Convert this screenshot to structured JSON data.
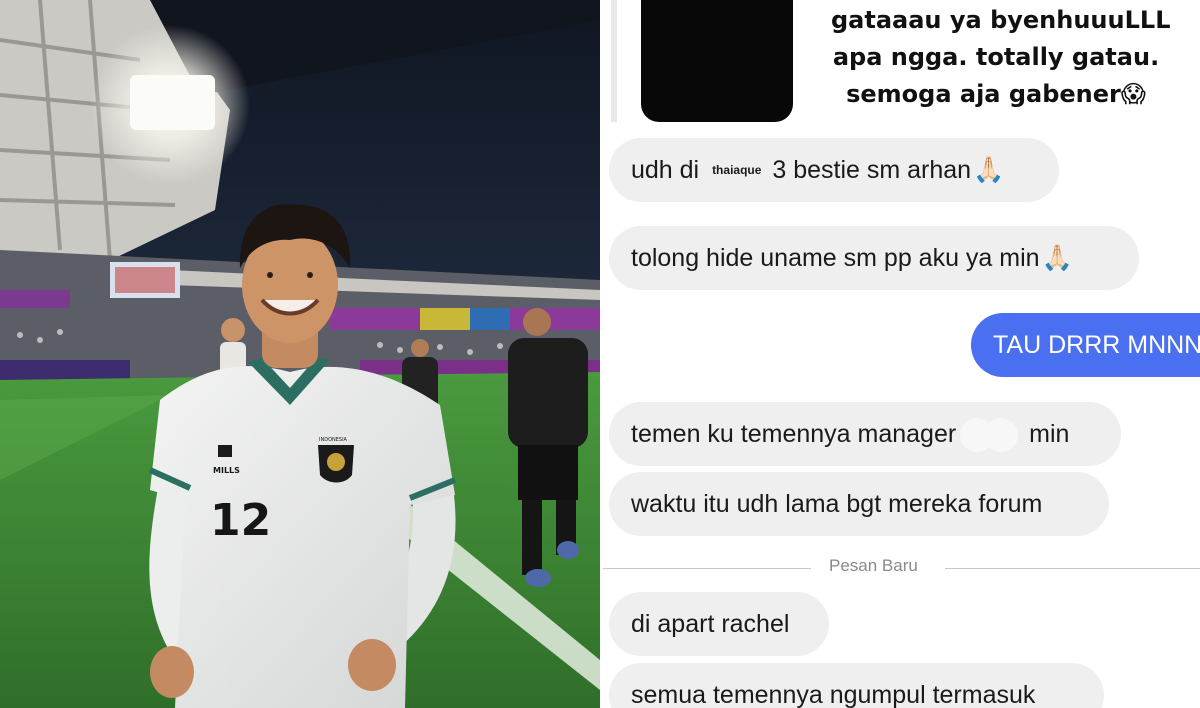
{
  "photo": {
    "jersey_number": "12",
    "kit_brand": "MILLS",
    "crest_text": "INDONESIA"
  },
  "chat": {
    "shared_post_text": [
      "gataaau ya byenhuuuLLL",
      "apa ngga. totally gatau.",
      "semoga aja gabener"
    ],
    "messages": [
      {
        "pre": "udh di ",
        "mini": "thaiaque",
        "post": " 3 bestie sm arhan",
        "emoji": "🙏🏻"
      },
      {
        "text": "tolong hide uname sm pp aku ya min",
        "emoji": "🙏🏻"
      },
      {
        "text": "TAU DRRR MNNN"
      },
      {
        "pre": "temen ku temennya manager",
        "post": " min"
      },
      {
        "text": "waktu itu udh lama bgt mereka forum"
      },
      {
        "separator": "Pesan Baru"
      },
      {
        "text": "di apart rachel"
      },
      {
        "text": "semua temennya ngumpul termasuk"
      }
    ],
    "emoji_shock": "😱"
  },
  "colors": {
    "sent_bubble": "#4a6ff1",
    "received_bubble": "#efefef",
    "pitch_green": "#3f8a36"
  }
}
